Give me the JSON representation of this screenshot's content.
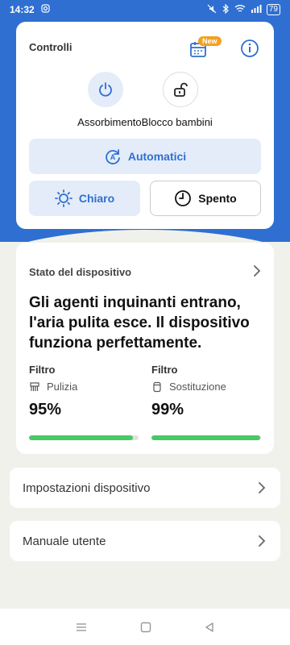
{
  "status_bar": {
    "time": "14:32",
    "battery": "79"
  },
  "controls": {
    "title": "Controlli",
    "new_badge": "New",
    "absorb_label": "Assorbimento",
    "child_lock_label": "Blocco bambini",
    "auto_label": "Automatici",
    "light_label": "Chiaro",
    "off_label": "Spento"
  },
  "device_status": {
    "title": "Stato del dispositivo",
    "message": "Gli agenti inquinanti entrano, l'aria pulita esce. Il dispositivo funziona perfettamente.",
    "filters": [
      {
        "label": "Filtro",
        "type": "Pulizia",
        "value": "95%",
        "progress": 0.95
      },
      {
        "label": "Filtro",
        "type": "Sostituzione",
        "value": "99%",
        "progress": 0.99
      }
    ]
  },
  "menu": {
    "settings": "Impostazioni dispositivo",
    "manual": "Manuale utente"
  },
  "colors": {
    "primary": "#2f6fd1",
    "accent": "#f3a020",
    "progress": "#4cc768"
  },
  "icons": {
    "absorb": "power-icon",
    "child_lock": "unlock-icon",
    "auto": "auto-mode-icon",
    "light": "sun-icon",
    "off": "clock-icon",
    "schedule": "calendar-icon",
    "info": "info-icon"
  }
}
